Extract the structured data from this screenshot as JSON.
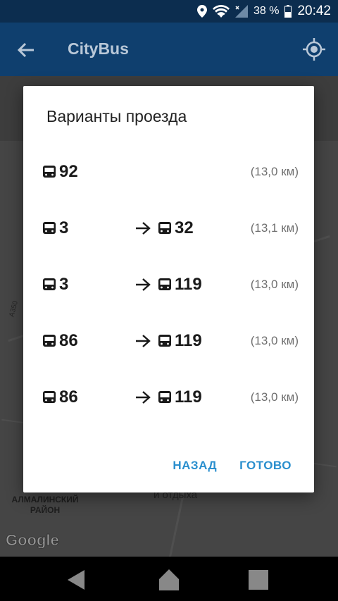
{
  "status_bar": {
    "battery": "38 %",
    "time": "20:42"
  },
  "app_bar": {
    "title": "CityBus"
  },
  "map": {
    "district_label": "АЛМАЛИНСКИЙ РАЙОН",
    "place_label": "и отдыха",
    "road_label": "A350",
    "attribution": "Google"
  },
  "dialog": {
    "title": "Варианты проезда",
    "routes": [
      {
        "first": "92",
        "second": "",
        "distance": "(13,0 км)"
      },
      {
        "first": "3",
        "second": "32",
        "distance": "(13,1 км)"
      },
      {
        "first": "3",
        "second": "119",
        "distance": "(13,0 км)"
      },
      {
        "first": "86",
        "second": "119",
        "distance": "(13,0 км)"
      },
      {
        "first": "86",
        "second": "119",
        "distance": "(13,0 км)"
      }
    ],
    "back_label": "НАЗАД",
    "done_label": "ГОТОВО"
  },
  "colors": {
    "status_bar": "#0c2d4f",
    "app_bar": "#0f3f6e",
    "accent": "#2b8fce"
  }
}
